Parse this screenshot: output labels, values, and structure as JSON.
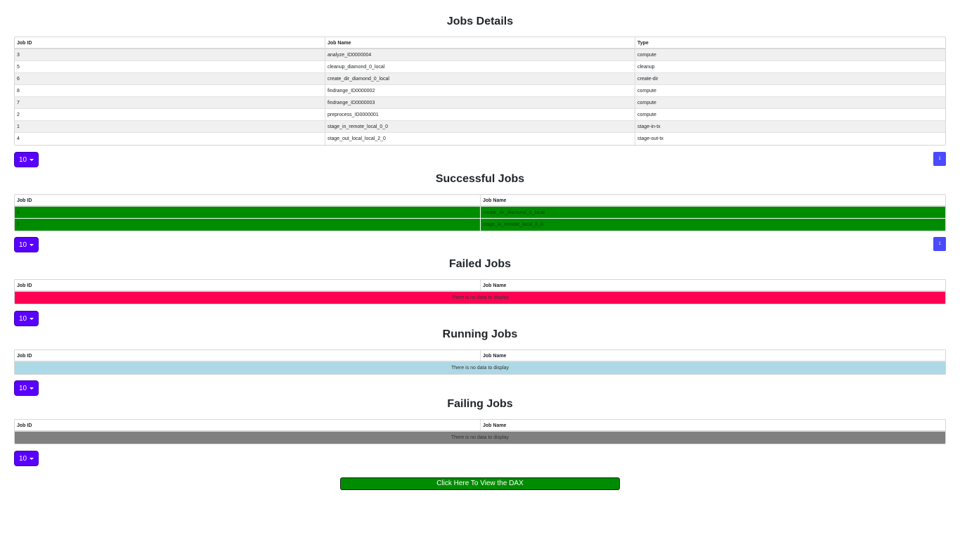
{
  "jobs_details": {
    "title": "Jobs Details",
    "columns": [
      "Job ID",
      "Job Name",
      "Type"
    ],
    "rows": [
      [
        "3",
        "analyze_ID0000004",
        "compute"
      ],
      [
        "5",
        "cleanup_diamond_0_local",
        "cleanup"
      ],
      [
        "6",
        "create_dir_diamond_0_local",
        "create-dir"
      ],
      [
        "8",
        "findrange_ID0000002",
        "compute"
      ],
      [
        "7",
        "findrange_ID0000003",
        "compute"
      ],
      [
        "2",
        "preprocess_ID0000001",
        "compute"
      ],
      [
        "1",
        "stage_in_remote_local_0_0",
        "stage-in-tx"
      ],
      [
        "4",
        "stage_out_local_local_2_0",
        "stage-out-tx"
      ]
    ],
    "page_size": "10",
    "page": "1"
  },
  "successful_jobs": {
    "title": "Successful Jobs",
    "columns": [
      "Job ID",
      "Job Name"
    ],
    "rows": [
      [
        "6",
        "create_dir_diamond_0_local"
      ],
      [
        "1",
        "stage_in_remote_local_0_0"
      ]
    ],
    "page_size": "10",
    "page": "1"
  },
  "failed_jobs": {
    "title": "Failed Jobs",
    "columns": [
      "Job ID",
      "Job Name"
    ],
    "empty_message": "There is no data to display",
    "page_size": "10"
  },
  "running_jobs": {
    "title": "Running Jobs",
    "columns": [
      "Job ID",
      "Job Name"
    ],
    "empty_message": "There is no data to display",
    "page_size": "10"
  },
  "failing_jobs": {
    "title": "Failing Jobs",
    "columns": [
      "Job ID",
      "Job Name"
    ],
    "empty_message": "There is no data to display",
    "page_size": "10"
  },
  "dax_button": {
    "label": "Click Here To View the DAX"
  },
  "colors": {
    "success_row": "#008c00",
    "failed_row": "#ff0055",
    "running_row": "#add8e6",
    "failing_row": "#808080",
    "page_size_button": "#5a00ff",
    "pager": "#4a4aff"
  }
}
